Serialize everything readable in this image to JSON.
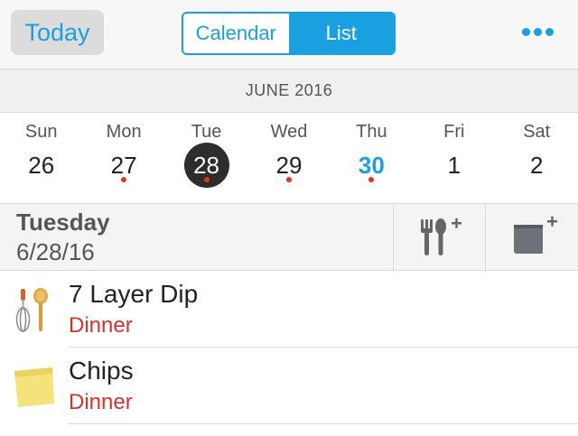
{
  "topbar": {
    "today_label": "Today",
    "segments": {
      "calendar": "Calendar",
      "list": "List"
    },
    "more_icon": "ellipsis-icon"
  },
  "calendar": {
    "month_label": "JUNE 2016",
    "days": [
      {
        "name": "Sun",
        "num": "26",
        "dot": false,
        "selected": false,
        "today": false
      },
      {
        "name": "Mon",
        "num": "27",
        "dot": true,
        "selected": false,
        "today": false
      },
      {
        "name": "Tue",
        "num": "28",
        "dot": true,
        "selected": true,
        "today": false
      },
      {
        "name": "Wed",
        "num": "29",
        "dot": true,
        "selected": false,
        "today": false
      },
      {
        "name": "Thu",
        "num": "30",
        "dot": true,
        "selected": false,
        "today": true
      },
      {
        "name": "Fri",
        "num": "1",
        "dot": false,
        "selected": false,
        "today": false
      },
      {
        "name": "Sat",
        "num": "2",
        "dot": false,
        "selected": false,
        "today": false
      }
    ]
  },
  "day_header": {
    "title": "Tuesday",
    "date": "6/28/16",
    "add_meal_icon": "add-meal-icon",
    "add_note_icon": "add-note-icon"
  },
  "items": [
    {
      "title": "7 Layer Dip",
      "meal": "Dinner",
      "icon": "whisk-spoon-icon"
    },
    {
      "title": "Chips",
      "meal": "Dinner",
      "icon": "sticky-note-icon"
    }
  ],
  "colors": {
    "accent": "#1a9fe0",
    "meal": "#d6322b",
    "event_dot": "#e03131"
  }
}
